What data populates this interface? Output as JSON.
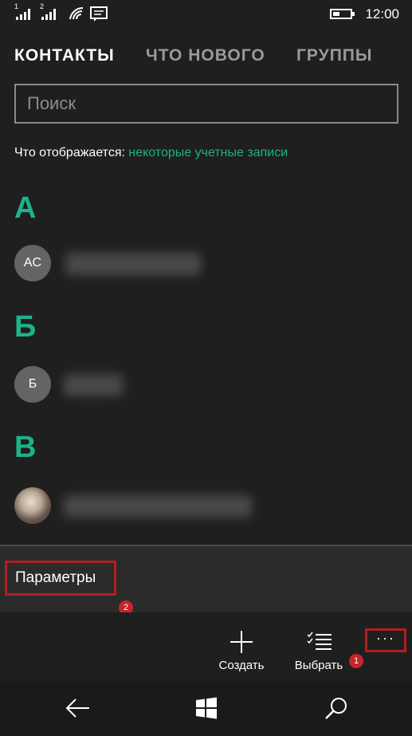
{
  "status_bar": {
    "sim1_label": "1",
    "sim2_label": "2",
    "clock": "12:00",
    "icons": [
      "signal-1-icon",
      "signal-2-icon",
      "wifi-icon",
      "message-icon",
      "battery-icon"
    ]
  },
  "tabs": [
    {
      "label": "КОНТАКТЫ",
      "active": true
    },
    {
      "label": "ЧТО НОВОГО",
      "active": false
    },
    {
      "label": "ГРУППЫ",
      "active": false
    }
  ],
  "search": {
    "placeholder": "Поиск",
    "value": ""
  },
  "filter": {
    "label": "Что отображается:",
    "link": "некоторые учетные записи"
  },
  "sections": [
    {
      "letter": "А",
      "contacts": [
        {
          "initials": "AC"
        }
      ]
    },
    {
      "letter": "Б",
      "contacts": [
        {
          "initials": "Б"
        }
      ]
    },
    {
      "letter": "В",
      "contacts": [
        {
          "initials": ""
        }
      ]
    }
  ],
  "menu": {
    "parameters_label": "Параметры",
    "badge": "2"
  },
  "appbar": {
    "create_label": "Создать",
    "select_label": "Выбрать",
    "more_label": "···",
    "badge": "1"
  },
  "colors": {
    "accent": "#1db28a",
    "highlight": "#b01f1f",
    "background": "#1f1f1f"
  }
}
